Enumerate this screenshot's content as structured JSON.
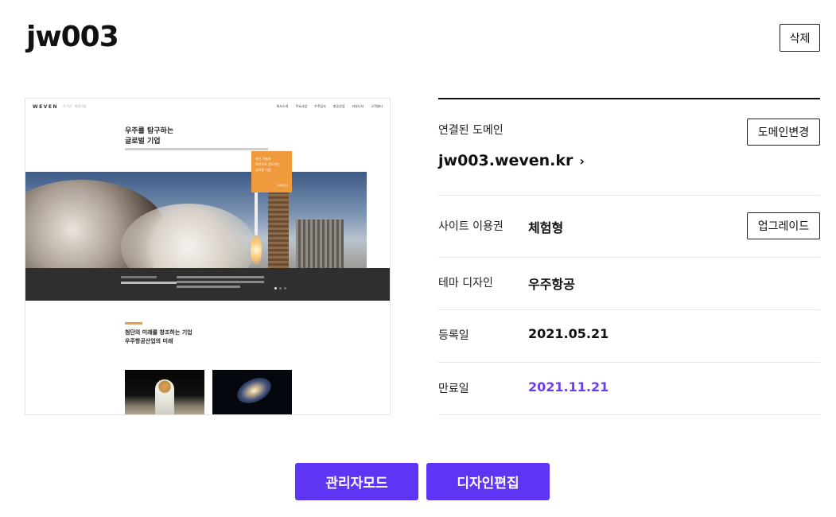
{
  "site": {
    "title": "jw003",
    "delete_label": "삭제"
  },
  "preview": {
    "logo": "WEVEN",
    "logo_sub": "로그인 · 회원가입",
    "menu": [
      "회사소개",
      "주요사업",
      "우주탐사",
      "항공산업",
      "커뮤니티",
      "고객센터"
    ],
    "hero_title_1": "우주를 탐구하는",
    "hero_title_2": "글로벌 기업",
    "orange_line_1": "최신 기술과",
    "orange_line_2": "혁신으로 선도하는",
    "orange_line_3": "글로벌 기업",
    "orange_more": "자세히보기",
    "section_title_1": "첨단의 미래를 창조하는 기업",
    "section_title_2": "우주항공산업의 미래"
  },
  "info": {
    "domain_label": "연결된 도메인",
    "domain_value": "jw003.weven.kr",
    "domain_change_label": "도메인변경",
    "plan_label": "사이트 이용권",
    "plan_value": "체험형",
    "upgrade_label": "업그레이드",
    "theme_label": "테마 디자인",
    "theme_value": "우주항공",
    "registered_label": "등록일",
    "registered_value": "2021.05.21",
    "expiry_label": "만료일",
    "expiry_value": "2021.11.21"
  },
  "actions": {
    "admin_mode_label": "관리자모드",
    "design_edit_label": "디자인편집"
  },
  "colors": {
    "primary": "#5e35f5",
    "expiry_text": "#6a3df5",
    "preview_accent": "#ef9a3c"
  }
}
